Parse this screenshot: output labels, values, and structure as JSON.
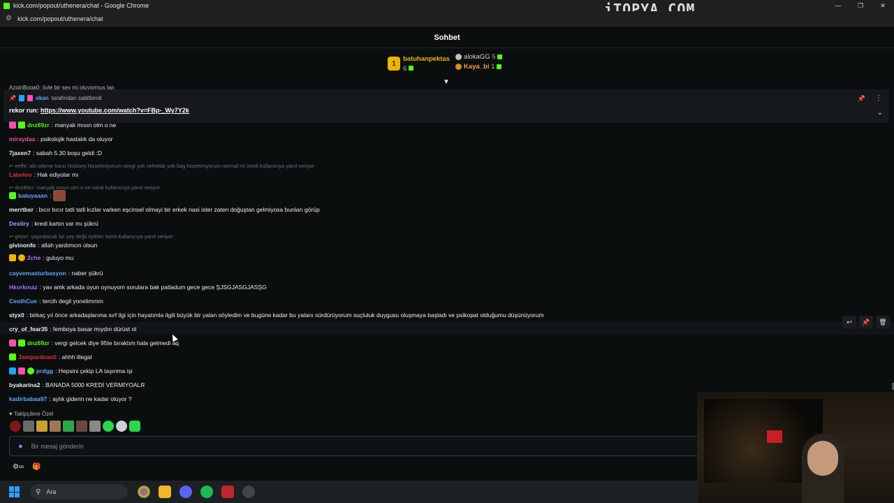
{
  "window": {
    "title": "kick.com/popout/uthenera/chat - Google Chrome",
    "url": "kick.com/popout/uthenera/chat",
    "watermark": "iTOPYA.COM",
    "controls": {
      "minimize": "—",
      "restore": "❐",
      "close": "✕"
    }
  },
  "chat": {
    "title": "Sohbet"
  },
  "leaderboard": {
    "first": {
      "rank": "1",
      "name": "batuhanpektas",
      "count": "6"
    },
    "second": {
      "name": "alokaGG",
      "count": "5"
    },
    "third": {
      "name": "Kaya_bi",
      "count": "1"
    }
  },
  "pinned": {
    "prev_line": "AzginBoga0: öyle bir şey mi oluyormuş lan",
    "pinned_by_user": "okan",
    "pinned_by_suffix": "tarafından sabitlendi",
    "label": "rekor run:",
    "link": "https://www.youtube.com/watch?v=FBp-_Wy7Y2k"
  },
  "messages": [
    {
      "user": "dnz69zr",
      "text": ": manyak mısın olm o ne",
      "color": "#53fc18"
    },
    {
      "user": "miraydaa",
      "text": ": psikolojik hastalık da oluyor",
      "color": "#e05a8a"
    },
    {
      "user": "7jaxen7",
      "text": ": sabah 5.30 boşu geldi :D",
      "color": "#efeff1"
    },
    {
      "reply": "eeffe: abi aileme karsı hicbisey hissetmiyorum sevgi yok nefretde yok bag hissetmiyorum normal mi isimli kullanıcıya yanıt veriyor"
    },
    {
      "user": "Labeloo",
      "text": ": Hak ediyolar mı",
      "color": "#e0303a"
    },
    {
      "reply": "dnz69zr: manyak mısın olm o ne isimli kullanıcıya yanıt veriyor"
    },
    {
      "user": "batuyaaan",
      "text": ":",
      "color": "#5ea8ff"
    },
    {
      "user": "merrtbsr",
      "text": ": bıcır bıcır tatli tatli kızlar varken eşcinsel olmayi bir erkek nasi ister zaten doğuştan gelmiyosa bunları görüp",
      "color": "#efeff1"
    },
    {
      "user": "Dextiry",
      "text": ": kredi kartın var mı şükrü",
      "color": "#9aa7ff"
    },
    {
      "reply": "gNorr: şaşıralacak bir şey değil öyleler isimli kullanıcıya yanıt veriyor"
    },
    {
      "user": "givinonfo",
      "text": ": allah yardımcın olsun",
      "color": "#efeff1"
    },
    {
      "user": "2che",
      "text": ": guluyo mu",
      "color": "#a970ff"
    },
    {
      "user": "cayvemasturbasyon",
      "text": ": naber şükrü",
      "color": "#5ea8ff"
    },
    {
      "user": "Hkorkmaz",
      "text": ": yav amk arkada oyun oynuyom sorulara bak patladum gece gece ŞJSGJASGJASŞG",
      "color": "#a970ff"
    },
    {
      "user": "CeothCue",
      "text": ": tercih degil yonelimmm",
      "color": "#5ea8ff"
    },
    {
      "user": "styx0",
      "text": ": birkaç yıl önce arkadaşlarıma sırf ilgi için hayatımla ilgili büyük bir yalan söyledim ve bugüne kadar bu yalanı sürdürüyorum suçluluk duygusu oluşmaya başladı ve psikopat olduğumu düşünüyorum",
      "color": "#efeff1"
    },
    {
      "user": "cry_of_fear35",
      "text": ": femboya basar mıydın dürüst ol",
      "color": "#efeff1"
    },
    {
      "user": "dnz69zr",
      "text": ": vergi gelcek diye 95te bıraktım hala gelmedi aq",
      "color": "#53fc18"
    },
    {
      "user": "Jampardean0",
      "text": ": ahhh illegal",
      "color": "#e0303a"
    },
    {
      "user": "prdgg",
      "text": ": Hepsini çekip LA taşınma işi",
      "color": "#5ea8ff"
    },
    {
      "user": "byakarina2",
      "text": ": BANADA 5000 KREDİ VERMİYOALR",
      "color": "#efeff1"
    },
    {
      "user": "kadirbabaa97",
      "text": ": aylık giderin ne kadar oluyor ?",
      "color": "#5ea8ff"
    }
  ],
  "footer": {
    "followers_only": "Takipçilere Özel",
    "input_placeholder": "Bir mesaj gönderin"
  },
  "taskbar": {
    "search_label": "Ara"
  }
}
